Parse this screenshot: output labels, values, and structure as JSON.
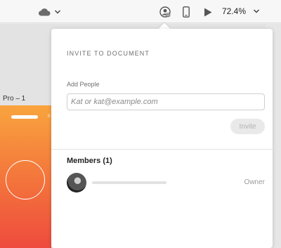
{
  "toolbar": {
    "cloud_icon": "cloud-icon",
    "zoom": "72.4%"
  },
  "canvas": {
    "artboard_label": "Pro – 1",
    "artboard_dot": "0"
  },
  "invite_popover": {
    "title": "INVITE TO DOCUMENT",
    "add_people_label": "Add People",
    "input_placeholder": "Kat or kat@example.com",
    "input_value": "",
    "invite_button": "Invite",
    "members_heading": "Members (1)",
    "members": [
      {
        "role": "Owner"
      }
    ]
  },
  "colors": {
    "accent": "#f9a43e",
    "artboard_bottom": "#ee4b3d"
  }
}
